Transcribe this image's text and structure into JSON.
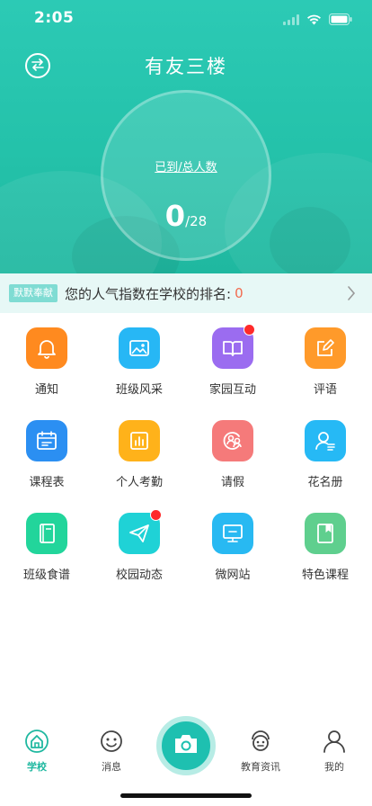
{
  "status_bar": {
    "time": "2:05"
  },
  "header": {
    "title": "有友三楼",
    "attendance_label": "已到/总人数",
    "attended": "0",
    "total": "/28"
  },
  "notice": {
    "tag": "默默奉献",
    "text": "您的人气指数在学校的排名:",
    "rank": "0"
  },
  "features": [
    {
      "label": "通知",
      "icon": "bell-icon",
      "color": "#ff8a1f",
      "badge": false
    },
    {
      "label": "班级风采",
      "icon": "picture-icon",
      "color": "#27b7f5",
      "badge": false
    },
    {
      "label": "家园互动",
      "icon": "book-icon",
      "color": "#9b6cf0",
      "badge": true
    },
    {
      "label": "评语",
      "icon": "edit-icon",
      "color": "#ff9a2a",
      "badge": false
    },
    {
      "label": "课程表",
      "icon": "calendar-icon",
      "color": "#2b8ff2",
      "badge": false
    },
    {
      "label": "个人考勤",
      "icon": "chart-icon",
      "color": "#ffb21a",
      "badge": false
    },
    {
      "label": "请假",
      "icon": "leave-icon",
      "color": "#f57a7a",
      "badge": false
    },
    {
      "label": "花名册",
      "icon": "roster-icon",
      "color": "#26b9f5",
      "badge": false
    },
    {
      "label": "班级食谱",
      "icon": "recipe-book-icon",
      "color": "#22d59b",
      "badge": false
    },
    {
      "label": "校园动态",
      "icon": "paper-plane-icon",
      "color": "#1fd2d6",
      "badge": true
    },
    {
      "label": "微网站",
      "icon": "monitor-icon",
      "color": "#28b9f2",
      "badge": false
    },
    {
      "label": "特色课程",
      "icon": "bookmark-book-icon",
      "color": "#5fcf8e",
      "badge": false
    }
  ],
  "tabbar": {
    "items": [
      {
        "label": "学校",
        "icon": "school-home-icon",
        "active": true
      },
      {
        "label": "消息",
        "icon": "smile-message-icon",
        "active": false
      },
      {
        "label": "教育资讯",
        "icon": "news-face-icon",
        "active": false
      },
      {
        "label": "我的",
        "icon": "person-icon",
        "active": false
      }
    ],
    "camera_icon": "camera-icon"
  },
  "colors": {
    "accent": "#1fb8a0",
    "notice_bg": "#e7f8f6",
    "rank": "#f26b4f"
  }
}
